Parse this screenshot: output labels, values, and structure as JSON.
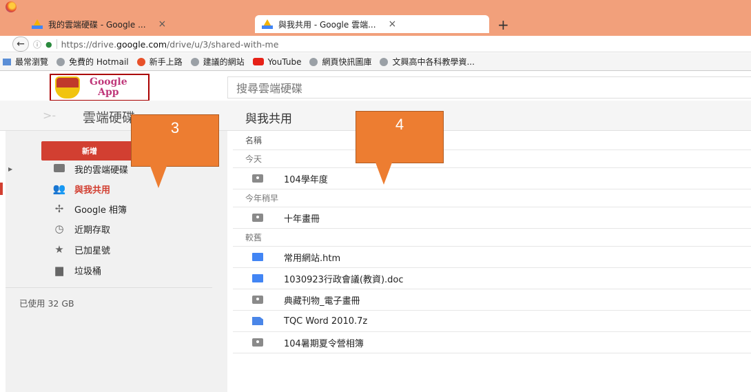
{
  "browser": {
    "tabs": [
      {
        "label": "我的雲端硬碟 - Google ...",
        "close": "×"
      },
      {
        "label": "與我共用 - Google 雲端...",
        "close": "×"
      }
    ],
    "new_tab": "+",
    "back": "←",
    "url_prefix": "https://drive.",
    "url_domain": "google.com",
    "url_path": "/drive/u/3/shared-with-me",
    "bookmarks": [
      {
        "label": "最常瀏覽",
        "icon": "folder-icon"
      },
      {
        "label": "免費的 Hotmail",
        "icon": "globe-icon"
      },
      {
        "label": "新手上路",
        "icon": "firefox-icon"
      },
      {
        "label": "建議的網站",
        "icon": "globe-icon"
      },
      {
        "label": "YouTube",
        "icon": "youtube-icon"
      },
      {
        "label": "網頁快訊圖庫",
        "icon": "globe-icon"
      },
      {
        "label": "文興高中各科教學資...",
        "icon": "globe-icon"
      }
    ]
  },
  "header": {
    "logo_line1": "Google",
    "logo_line2": "App",
    "search_placeholder": "搜尋雲端硬碟"
  },
  "subheader": {
    "drive_title": "雲端硬碟",
    "page_title": "與我共用"
  },
  "sidebar": {
    "new_button": "新增",
    "items": [
      {
        "label": "我的雲端硬碟",
        "icon": "drive-folder-icon"
      },
      {
        "label": "與我共用",
        "icon": "people-icon",
        "active": true
      },
      {
        "label": "Google 相簿",
        "icon": "photos-icon"
      },
      {
        "label": "近期存取",
        "icon": "clock-icon"
      },
      {
        "label": "已加星號",
        "icon": "star-icon"
      },
      {
        "label": "垃圾桶",
        "icon": "trash-icon"
      }
    ],
    "storage": "已使用 32 GB"
  },
  "list": {
    "column_name": "名稱",
    "sections": [
      {
        "label": "今天",
        "files": [
          {
            "name": "104學年度",
            "icon": "shared-folder-icon"
          }
        ]
      },
      {
        "label": "今年稍早",
        "files": [
          {
            "name": "十年畫冊",
            "icon": "shared-folder-icon"
          }
        ]
      },
      {
        "label": "較舊",
        "files": [
          {
            "name": "常用網站.htm",
            "icon": "doc-icon"
          },
          {
            "name": "1030923行政會議(教資).doc",
            "icon": "doc-icon"
          },
          {
            "name": "典藏刊物_電子畫冊",
            "icon": "shared-folder-icon"
          },
          {
            "name": "TQC Word 2010.7z",
            "icon": "file-icon"
          },
          {
            "name": "104暑期夏令營相簿",
            "icon": "shared-folder-icon"
          }
        ]
      }
    ]
  },
  "callouts": [
    "3",
    "4"
  ],
  "colors": {
    "accent_red": "#d23f31",
    "callout_orange": "#ed7d31",
    "titlebar": "#f2a07b"
  }
}
